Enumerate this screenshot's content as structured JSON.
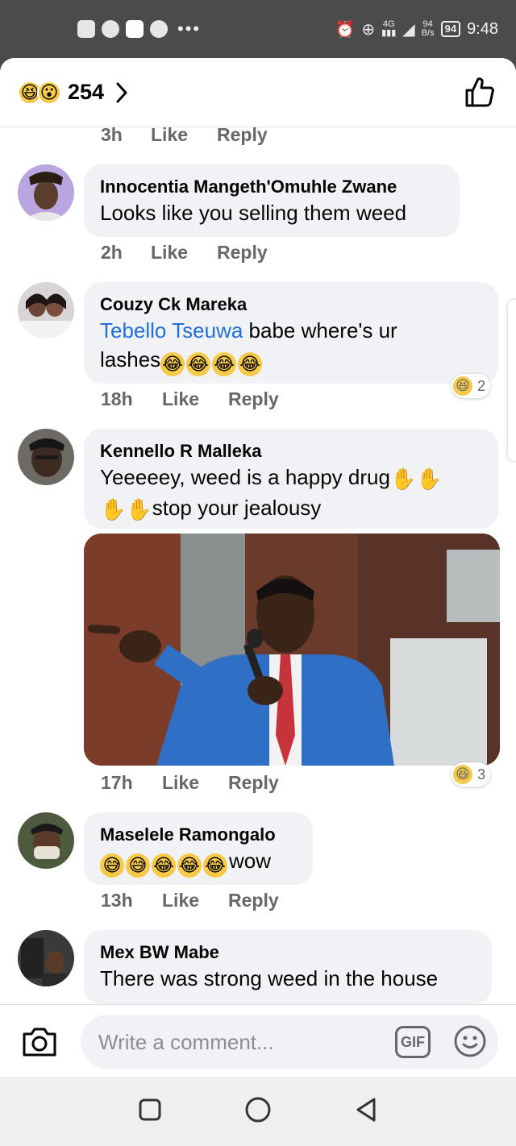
{
  "status_bar": {
    "network_speed_value": "94",
    "network_speed_unit": "B/s",
    "network_type": "4G",
    "battery": "94",
    "time": "9:48"
  },
  "header": {
    "reaction_emojis": [
      "😆",
      "😮"
    ],
    "reaction_count": "254"
  },
  "comments": [
    {
      "meta": {
        "time": "3h",
        "like": "Like",
        "reply": "Reply"
      }
    },
    {
      "name": "Innocentia Mangeth'Omuhle Zwane",
      "text": "Looks like you selling them weed",
      "meta": {
        "time": "2h",
        "like": "Like",
        "reply": "Reply"
      }
    },
    {
      "name": "Couzy Ck Mareka",
      "mention": "Tebello Tseuwa",
      "text_after_mention": " babe where's ur",
      "text_line2": "lashes",
      "emojis": [
        "😂",
        "😂",
        "😂",
        "😂"
      ],
      "reaction": {
        "emoji": "😆",
        "count": "2"
      },
      "meta": {
        "time": "18h",
        "like": "Like",
        "reply": "Reply"
      }
    },
    {
      "name": "Kennello R Malleka",
      "text_line1": "Yeeeeey, weed is a happy drug",
      "hands_line1": [
        "✋",
        "✋"
      ],
      "hands_line2": [
        "✋",
        "✋"
      ],
      "text_line2": "stop your jealousy",
      "reaction": {
        "emoji": "😆",
        "count": "3"
      },
      "meta": {
        "time": "17h",
        "like": "Like",
        "reply": "Reply"
      }
    },
    {
      "name": "Maselele Ramongalo",
      "emojis": [
        "😅",
        "😅",
        "😂",
        "😂",
        "😂"
      ],
      "text": "wow",
      "meta": {
        "time": "13h",
        "like": "Like",
        "reply": "Reply"
      }
    },
    {
      "name": "Mex BW Mabe",
      "text": "There was strong weed in the house"
    }
  ],
  "composer": {
    "placeholder": "Write a comment...",
    "gif_label": "GIF"
  }
}
